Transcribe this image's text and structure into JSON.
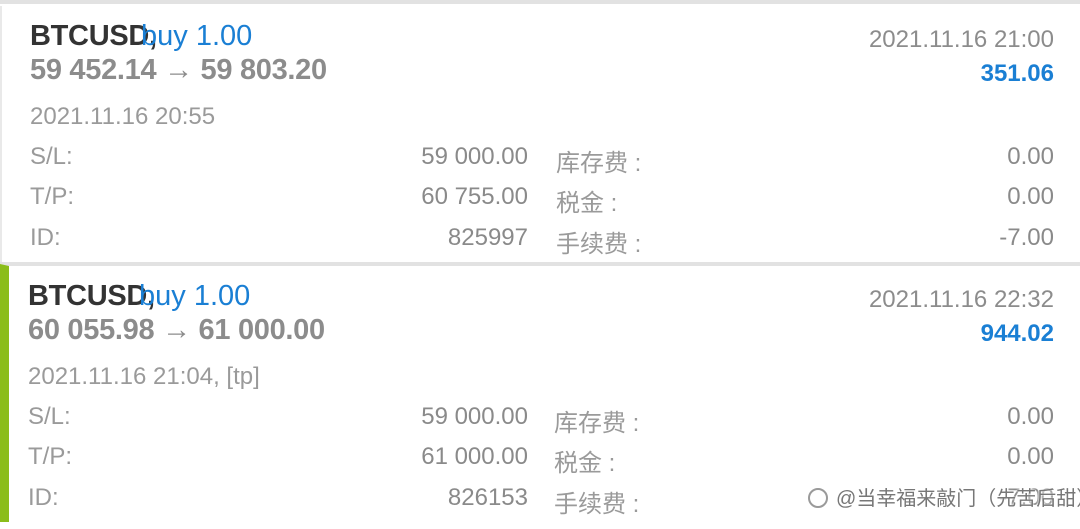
{
  "trades": [
    {
      "symbol": "BTCUSD,",
      "side": "buy 1.00",
      "price_move": "59 452.14 → 59 803.20",
      "close_time": "2021.11.16 21:00",
      "profit": "351.06",
      "open_time": "2021.11.16 20:55",
      "sl_label": "S/L:",
      "sl_value": "59 000.00",
      "tp_label": "T/P:",
      "tp_value": "60 755.00",
      "id_label": "ID:",
      "id_value": "825997",
      "swap_label": "库存费 :",
      "swap_value": "0.00",
      "tax_label": "税金 :",
      "tax_value": "0.00",
      "fee_label": "手续费 :",
      "fee_value": "-7.00"
    },
    {
      "symbol": "BTCUSD,",
      "side": "buy 1.00",
      "price_move": "60 055.98 → 61 000.00",
      "close_time": "2021.11.16 22:32",
      "profit": "944.02",
      "open_time": "2021.11.16 21:04, [tp]",
      "sl_label": "S/L:",
      "sl_value": "59 000.00",
      "tp_label": "T/P:",
      "tp_value": "61 000.00",
      "id_label": "ID:",
      "id_value": "826153",
      "swap_label": "库存费 :",
      "swap_value": "0.00",
      "tax_label": "税金 :",
      "tax_value": "0.00",
      "fee_label": "手续费 :",
      "fee_value": "-7.00"
    }
  ],
  "watermark": "@当幸福来敲门（先苦后甜）",
  "colors": {
    "accent_blue": "#1a7fd4",
    "profit_bar": "#8bbd1a"
  }
}
